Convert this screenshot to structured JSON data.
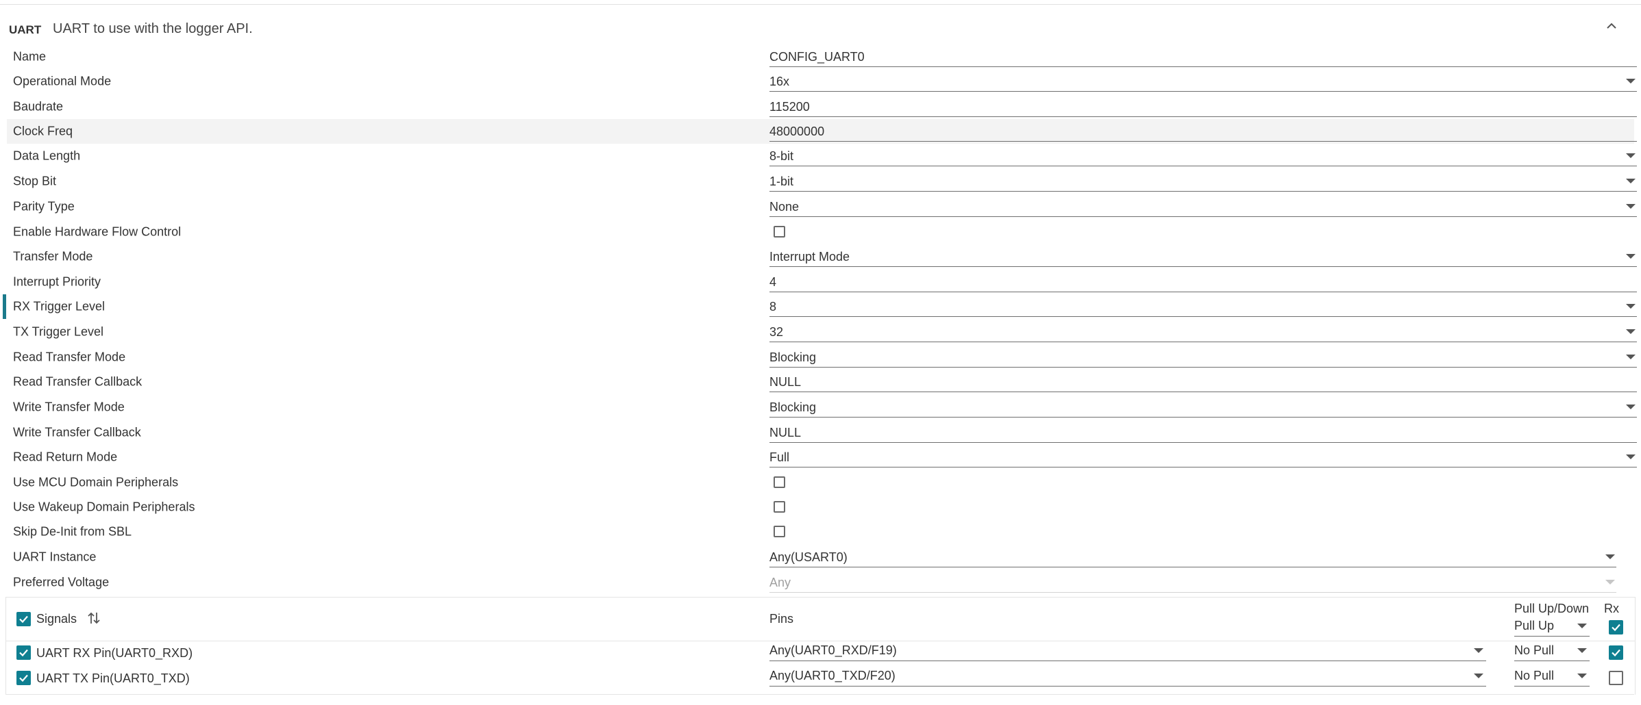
{
  "section": {
    "title": "UART",
    "description": "UART to use with the logger API."
  },
  "fields": {
    "name": {
      "label": "Name",
      "value": "CONFIG_UART0"
    },
    "operational_mode": {
      "label": "Operational Mode",
      "value": "16x"
    },
    "baudrate": {
      "label": "Baudrate",
      "value": "115200"
    },
    "clock_freq": {
      "label": "Clock Freq",
      "value": "48000000"
    },
    "data_length": {
      "label": "Data Length",
      "value": "8-bit"
    },
    "stop_bit": {
      "label": "Stop Bit",
      "value": "1-bit"
    },
    "parity_type": {
      "label": "Parity Type",
      "value": "None"
    },
    "hw_flow_control": {
      "label": "Enable Hardware Flow Control",
      "checked": false
    },
    "transfer_mode": {
      "label": "Transfer Mode",
      "value": "Interrupt Mode"
    },
    "interrupt_priority": {
      "label": "Interrupt Priority",
      "value": "4"
    },
    "rx_trigger_level": {
      "label": "RX Trigger Level",
      "value": "8"
    },
    "tx_trigger_level": {
      "label": "TX Trigger Level",
      "value": "32"
    },
    "read_transfer_mode": {
      "label": "Read Transfer Mode",
      "value": "Blocking"
    },
    "read_transfer_callback": {
      "label": "Read Transfer Callback",
      "value": "NULL"
    },
    "write_transfer_mode": {
      "label": "Write Transfer Mode",
      "value": "Blocking"
    },
    "write_transfer_callback": {
      "label": "Write Transfer Callback",
      "value": "NULL"
    },
    "read_return_mode": {
      "label": "Read Return Mode",
      "value": "Full"
    },
    "use_mcu_domain": {
      "label": "Use MCU Domain Peripherals",
      "checked": false
    },
    "use_wakeup_domain": {
      "label": "Use Wakeup Domain Peripherals",
      "checked": false
    },
    "skip_deinit_sbl": {
      "label": "Skip De-Init from SBL",
      "checked": false
    },
    "uart_instance": {
      "label": "UART Instance",
      "value": "Any(USART0)"
    },
    "preferred_voltage": {
      "label": "Preferred Voltage",
      "value": "Any"
    }
  },
  "signals_table": {
    "signals_header": "Signals",
    "pins_header": "Pins",
    "pull_header": "Pull Up/Down",
    "pull_header_value": "Pull Up",
    "rx_header": "Rx",
    "rows": [
      {
        "signal": "UART RX Pin(UART0_RXD)",
        "pin": "Any(UART0_RXD/F19)",
        "pull": "No Pull",
        "rx": true
      },
      {
        "signal": "UART TX Pin(UART0_TXD)",
        "pin": "Any(UART0_TXD/F20)",
        "pull": "No Pull",
        "rx": false
      }
    ]
  },
  "colors": {
    "accent": "#0f7f91",
    "marker": "#1b7a8c"
  }
}
